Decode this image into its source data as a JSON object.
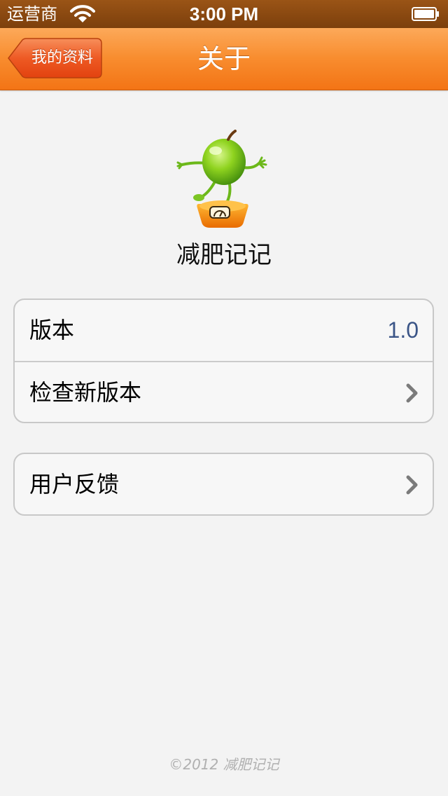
{
  "status_bar": {
    "carrier": "运营商",
    "time": "3:00 PM",
    "wifi_icon": "wifi-icon",
    "battery_icon": "battery-icon"
  },
  "nav_bar": {
    "title": "关于",
    "back_label": "我的资料",
    "color": "#f88c2e"
  },
  "app": {
    "logo_icon": "apple-on-scale-logo",
    "name": "减肥记记"
  },
  "groups": [
    {
      "rows": [
        {
          "label": "版本",
          "value": "1.0"
        },
        {
          "label": "检查新版本",
          "accessory": "chevron-right-icon"
        }
      ]
    },
    {
      "rows": [
        {
          "label": "用户反馈",
          "accessory": "chevron-right-icon"
        }
      ]
    }
  ],
  "footer": "©2012 减肥记记"
}
